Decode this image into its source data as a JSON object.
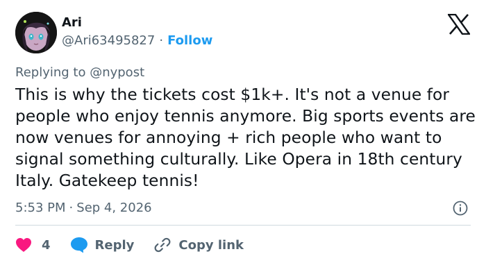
{
  "author": {
    "display_name": "Ari",
    "handle": "@Ari63495827",
    "separator": "·",
    "follow_label": "Follow"
  },
  "reply_context": "Replying to @nypost",
  "tweet": {
    "text": "This is why the tickets cost $1k+. It's not a venue for people who enjoy tennis anymore. Big sports events are now venues for annoying + rich people who want to signal something culturally. Like Opera in 18th century Italy. Gatekeep tennis!"
  },
  "meta": {
    "time": "5:53 PM",
    "separator": "·",
    "date": "Sep 4, 2026"
  },
  "actions": {
    "like_count": "4",
    "reply_label": "Reply",
    "copy_link_label": "Copy link"
  },
  "colors": {
    "like": "#f91880",
    "reply": "#1d9bf0",
    "link": "#1d9bf0",
    "secondary_text": "#536471"
  },
  "icons": {
    "brand": "x-logo-icon",
    "info": "info-icon",
    "like": "heart-icon",
    "reply": "speech-bubble-icon",
    "copy": "link-icon"
  }
}
